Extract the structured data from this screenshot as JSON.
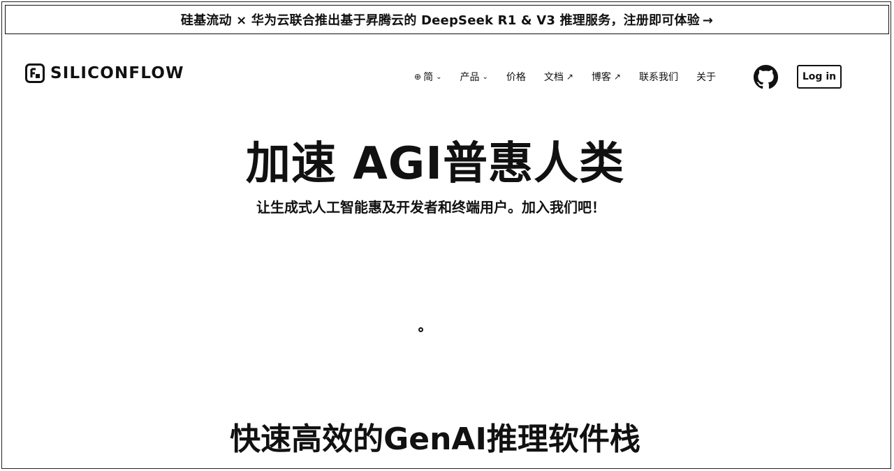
{
  "banner": {
    "text": "硅基流动 × 华为云联合推出基于昇腾云的 DeepSeek R1 & V3 推理服务，注册即可体验",
    "arrow": "→"
  },
  "header": {
    "logo_text": "SILICONFLOW",
    "nav": {
      "language": {
        "icon": "globe-icon",
        "label": "简"
      },
      "products": "产品",
      "pricing": "价格",
      "docs": "文档",
      "blog": "博客",
      "contact": "联系我们",
      "about": "关于"
    },
    "github_icon": "github-icon",
    "login_label": "Log in"
  },
  "hero": {
    "title": "加速 AGI普惠人类",
    "subtitle": "让生成式人工智能惠及开发者和终端用户。加入我们吧！"
  },
  "section": {
    "title": "快速高效的GenAI推理软件栈"
  }
}
